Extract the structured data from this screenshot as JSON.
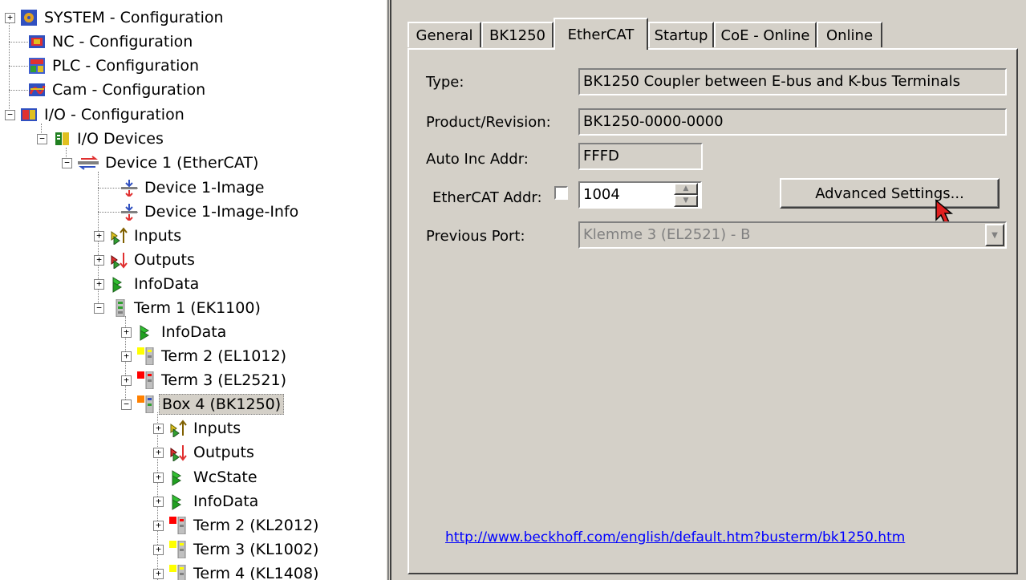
{
  "tree": {
    "nodes": [
      {
        "label": "SYSTEM - Configuration",
        "icon": "system-config-icon"
      },
      {
        "label": "NC - Configuration",
        "icon": "nc-config-icon"
      },
      {
        "label": "PLC - Configuration",
        "icon": "plc-config-icon"
      },
      {
        "label": "Cam - Configuration",
        "icon": "cam-config-icon"
      },
      {
        "label": "I/O - Configuration",
        "icon": "io-config-icon"
      },
      {
        "label": "I/O Devices",
        "icon": "io-devices-icon"
      },
      {
        "label": "Device 1 (EtherCAT)",
        "icon": "ethercat-device-icon"
      },
      {
        "label": "Device 1-Image",
        "icon": "process-image-icon"
      },
      {
        "label": "Device 1-Image-Info",
        "icon": "process-image-icon"
      },
      {
        "label": "Inputs",
        "icon": "inputs-icon"
      },
      {
        "label": "Outputs",
        "icon": "outputs-icon"
      },
      {
        "label": "InfoData",
        "icon": "infodata-icon"
      },
      {
        "label": "Term 1 (EK1100)",
        "icon": "terminal-icon"
      },
      {
        "label": "InfoData",
        "icon": "infodata-icon"
      },
      {
        "label": "Term 2 (EL1012)",
        "icon": "terminal-yellow-icon"
      },
      {
        "label": "Term 3 (EL2521)",
        "icon": "terminal-red-icon"
      },
      {
        "label": "Box 4 (BK1250)",
        "icon": "terminal-orange-icon"
      },
      {
        "label": "Inputs",
        "icon": "inputs-icon"
      },
      {
        "label": "Outputs",
        "icon": "outputs-icon"
      },
      {
        "label": "WcState",
        "icon": "infodata-icon"
      },
      {
        "label": "InfoData",
        "icon": "infodata-icon"
      },
      {
        "label": "Term 2 (KL2012)",
        "icon": "terminal-red-icon"
      },
      {
        "label": "Term 3 (KL1002)",
        "icon": "terminal-yellow-icon"
      },
      {
        "label": "Term 4 (KL1408)",
        "icon": "terminal-yellow-icon"
      }
    ],
    "selected_label": "Box 4 (BK1250)"
  },
  "tabs": [
    "General",
    "BK1250",
    "EtherCAT",
    "Startup",
    "CoE - Online",
    "Online"
  ],
  "active_tab": "EtherCAT",
  "form": {
    "type_label": "Type:",
    "type_value": "BK1250 Coupler between E-bus and K-bus Terminals",
    "product_label": "Product/Revision:",
    "product_value": "BK1250-0000-0000",
    "autoinc_label": "Auto Inc Addr:",
    "autoinc_value": "FFFD",
    "ethercat_addr_label": "EtherCAT Addr:",
    "ethercat_addr_value": "1004",
    "ethercat_addr_checked": false,
    "advanced_button": "Advanced Settings...",
    "prev_port_label": "Previous Port:",
    "prev_port_value": "Klemme 3 (EL2521) - B"
  },
  "link": "http://www.beckhoff.com/english/default.htm?busterm/bk1250.htm",
  "colors": {
    "face": "#d4d0c8",
    "link": "#0000ff",
    "selection": "#d4d0c8",
    "yellow": "#ffff00",
    "red": "#ff0000",
    "orange": "#ff8000",
    "green": "#00a000"
  }
}
